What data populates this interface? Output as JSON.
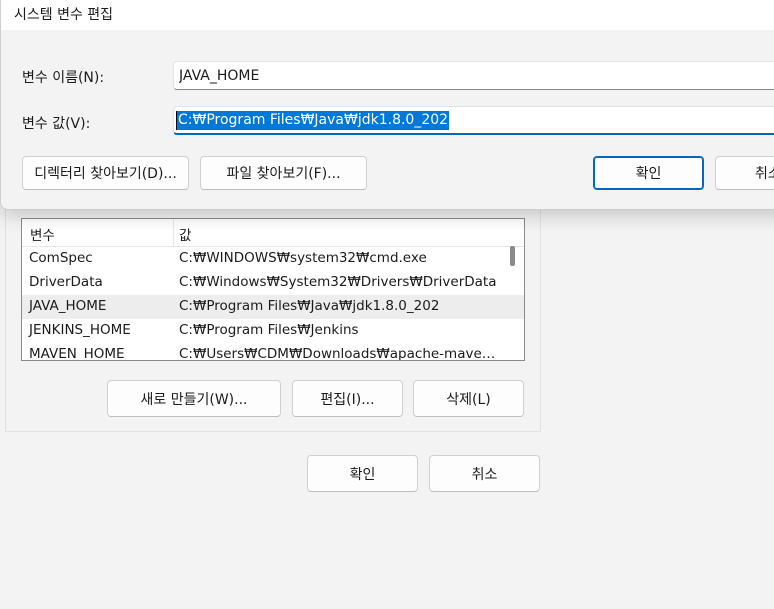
{
  "dialog": {
    "title": "시스템 변수 편집",
    "name_label": "변수 이름(N):",
    "name_value": "JAVA_HOME",
    "value_label": "변수 값(V):",
    "value_value": "C:₩Program Files₩Java₩jdk1.8.0_202",
    "browse_dir_label": "디렉터리 찾아보기(D)...",
    "browse_file_label": "파일 찾아보기(F)...",
    "ok_label": "확인",
    "cancel_label": "취소"
  },
  "env_table": {
    "columns": [
      "변수",
      "값"
    ],
    "rows": [
      {
        "name": "ComSpec",
        "value": "C:₩WINDOWS₩system32₩cmd.exe"
      },
      {
        "name": "DriverData",
        "value": "C:₩Windows₩System32₩Drivers₩DriverData"
      },
      {
        "name": "JAVA_HOME",
        "value": "C:₩Program Files₩Java₩jdk1.8.0_202"
      },
      {
        "name": "JENKINS_HOME",
        "value": "C:₩Program Files₩Jenkins"
      },
      {
        "name": "MAVEN_HOME",
        "value": "C:₩Users₩CDM₩Downloads₩apache-maven..."
      }
    ],
    "selected_row": 2
  },
  "parent_buttons": {
    "new_label": "새로 만들기(W)...",
    "edit_label": "편집(I)...",
    "delete_label": "삭제(L)",
    "ok_label": "확인",
    "cancel_label": "취소"
  }
}
